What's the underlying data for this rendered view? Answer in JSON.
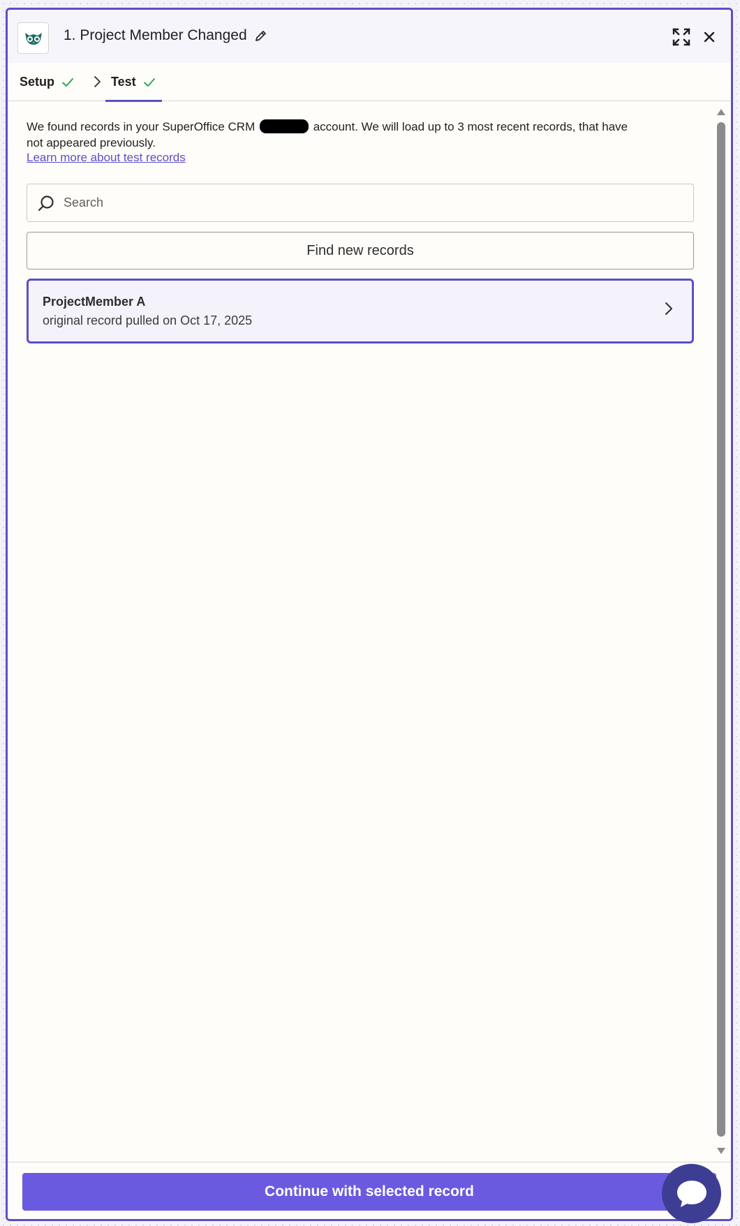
{
  "header": {
    "title": "1. Project Member Changed",
    "app_icon": "owl-logo-icon"
  },
  "tabs": [
    {
      "label": "Setup",
      "status": "complete"
    },
    {
      "label": "Test",
      "status": "complete",
      "active": true
    }
  ],
  "content": {
    "intro_before": "We found records in your SuperOffice CRM ",
    "intro_after": " account. We will load up to 3 most recent records, that have not appeared previously.",
    "learn_more": "Learn more about test records",
    "search": {
      "placeholder": "Search",
      "value": ""
    },
    "find_button": "Find new records",
    "records": [
      {
        "name": "ProjectMember A",
        "subtitle": "original record pulled on Oct 17, 2025",
        "selected": true
      }
    ]
  },
  "footer": {
    "continue_button": "Continue with selected record"
  },
  "colors": {
    "accent": "#5b4fc8",
    "primary_button": "#6a5ae0",
    "check": "#2fa35a",
    "chat": "#3d3e93"
  }
}
